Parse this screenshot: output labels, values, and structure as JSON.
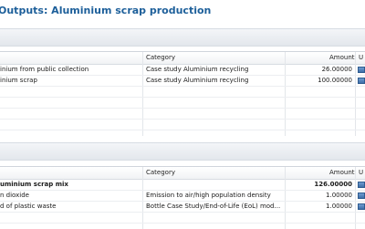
{
  "title": "Outputs: Aluminium scrap production",
  "inputs_table": {
    "columns": {
      "flow": "",
      "category": "Category",
      "amount": "Amount",
      "unit": "U"
    },
    "rows": [
      {
        "flow": "inium from public collection",
        "category": "Case study Aluminium recycling",
        "amount": "26.00000"
      },
      {
        "flow": "inium scrap",
        "category": "Case study Aluminium recycling",
        "amount": "100.00000"
      }
    ]
  },
  "outputs_table": {
    "columns": {
      "flow": "",
      "category": "Category",
      "amount": "Amount",
      "unit": "U"
    },
    "rows": [
      {
        "flow": "uminium scrap mix",
        "category": "",
        "amount": "126.00000",
        "bold": true
      },
      {
        "flow": "n dioxide",
        "category": "Emission to air/high population density",
        "amount": "1.00000"
      },
      {
        "flow": "d of plastic waste",
        "category": "Bottle Case Study/End-of-Life (EoL) mod...",
        "amount": "1.00000"
      }
    ]
  },
  "colors": {
    "title": "#1d5f9a",
    "unit_icon": "#3f6fa8"
  },
  "icons": {
    "unit": "unit-icon"
  }
}
